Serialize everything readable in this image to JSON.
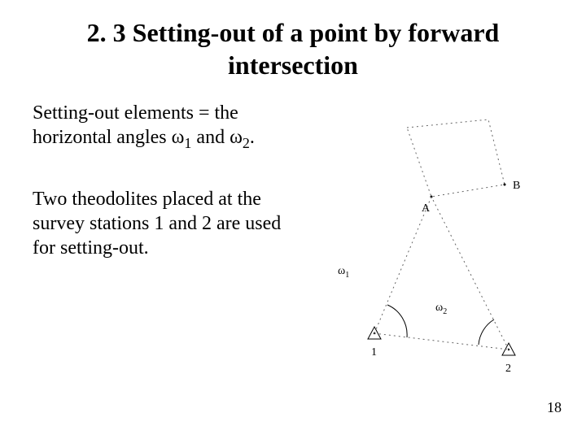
{
  "title": "2. 3 Setting-out of a point by forward intersection",
  "paragraph1_prefix": "Setting-out elements = the horizontal angles ",
  "omega": "ω",
  "sub1": "1",
  "mid_and": " and ",
  "sub2": "2",
  "p1_suffix": ".",
  "paragraph2": "Two theodolites placed at the survey stations 1 and 2 are used for setting-out.",
  "page_number": "18",
  "diagram": {
    "label_A": "A",
    "label_B": "B",
    "label_w1": "ω",
    "label_w1_sub": "1",
    "label_w2": "ω",
    "label_w2_sub": "2",
    "station_1": "1",
    "station_2": "2"
  }
}
